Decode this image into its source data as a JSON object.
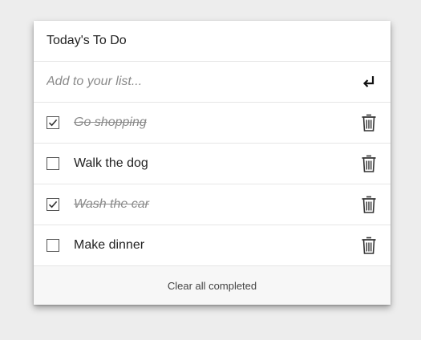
{
  "list": {
    "title": "Today's To Do",
    "add_placeholder": "Add to your list...",
    "add_value": "",
    "submit_icon": "enter-return-icon",
    "items": [
      {
        "label": "Go shopping",
        "completed": true
      },
      {
        "label": "Walk the dog",
        "completed": false
      },
      {
        "label": "Wash the car",
        "completed": true
      },
      {
        "label": "Make dinner",
        "completed": false
      }
    ],
    "clear_label": "Clear all completed"
  },
  "colors": {
    "background": "#ededed",
    "card": "#ffffff",
    "footer": "#f7f7f7",
    "completed_text": "#8a8a8a"
  }
}
